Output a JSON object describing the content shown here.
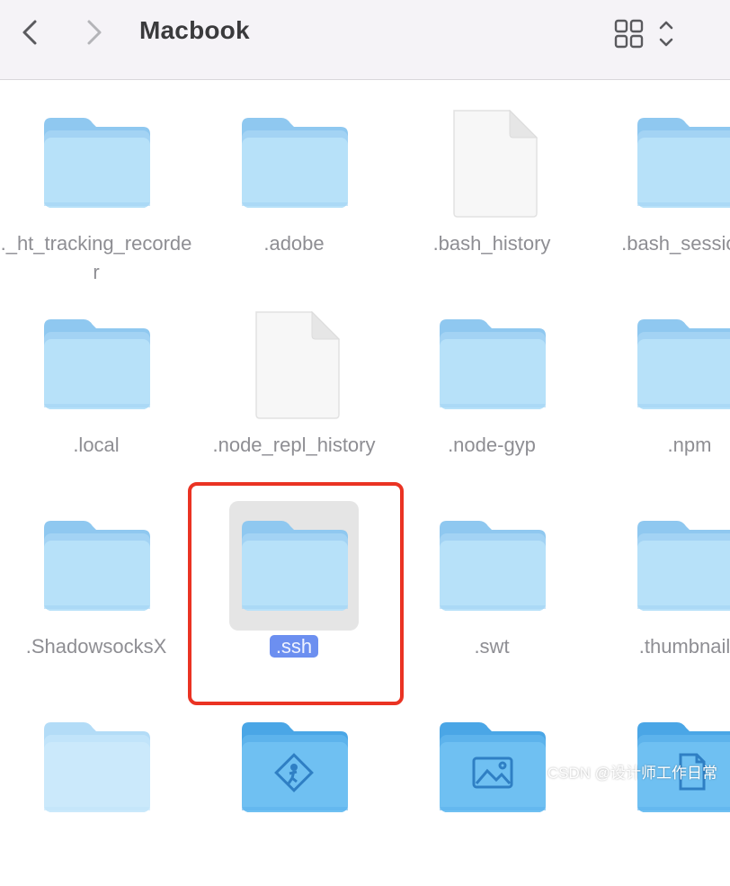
{
  "toolbar": {
    "title": "Macbook",
    "back_icon": "chevron-left-icon",
    "forward_icon": "chevron-right-icon",
    "view_icon": "grid-view-icon"
  },
  "items": [
    {
      "label": "._ht_tracking_recorder",
      "type": "folder"
    },
    {
      "label": ".adobe",
      "type": "folder"
    },
    {
      "label": ".bash_history",
      "type": "document"
    },
    {
      "label": ".bash_sessions",
      "type": "folder"
    },
    {
      "label": ".local",
      "type": "folder"
    },
    {
      "label": ".node_repl_history",
      "type": "document"
    },
    {
      "label": ".node-gyp",
      "type": "folder"
    },
    {
      "label": ".npm",
      "type": "folder"
    },
    {
      "label": ".ShadowsocksX",
      "type": "folder"
    },
    {
      "label": ".ssh",
      "type": "folder",
      "selected": true
    },
    {
      "label": ".swt",
      "type": "folder"
    },
    {
      "label": ".thumbnails",
      "type": "folder"
    },
    {
      "label": "",
      "type": "folder-light"
    },
    {
      "label": "",
      "type": "folder-applications"
    },
    {
      "label": "",
      "type": "folder-pictures"
    },
    {
      "label": "",
      "type": "folder-documents"
    }
  ],
  "colors": {
    "accent": "#6c8ff0",
    "highlight_box": "#ea3323",
    "folder": "#a9d7f6"
  },
  "watermark": "CSDN @设计师工作日常"
}
